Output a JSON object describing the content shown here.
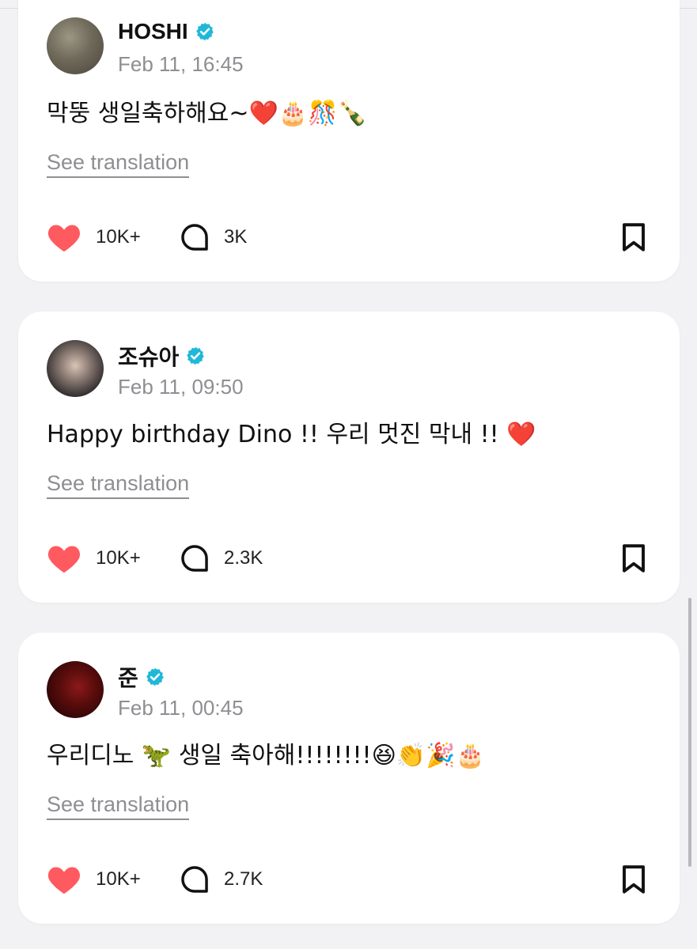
{
  "posts": [
    {
      "author": "HOSHI",
      "date": "Feb 11, 16:45",
      "message": "막뚱 생일축하해요~❤️🎂🎊🍾",
      "translate_label": "See translation",
      "likes": "10K+",
      "comments": "3K"
    },
    {
      "author": "조슈아",
      "date": "Feb 11, 09:50",
      "message": "Happy birthday Dino !! 우리 멋진 막내 !! ❤️",
      "translate_label": "See translation",
      "likes": "10K+",
      "comments": "2.3K"
    },
    {
      "author": "준",
      "date": "Feb 11, 00:45",
      "message": "우리디노 🦖 생일 축아해!!!!!!!!😆👏🎉🎂",
      "translate_label": "See translation",
      "likes": "10K+",
      "comments": "2.7K"
    }
  ],
  "colors": {
    "like": "#ff5a5f",
    "verified": "#1fb8d9",
    "muted_text": "#8e8e93",
    "background": "#f2f2f4"
  },
  "icons": {
    "like": "heart-icon",
    "comment": "comment-bubble-icon",
    "bookmark": "bookmark-icon",
    "verified": "verified-badge-icon"
  }
}
